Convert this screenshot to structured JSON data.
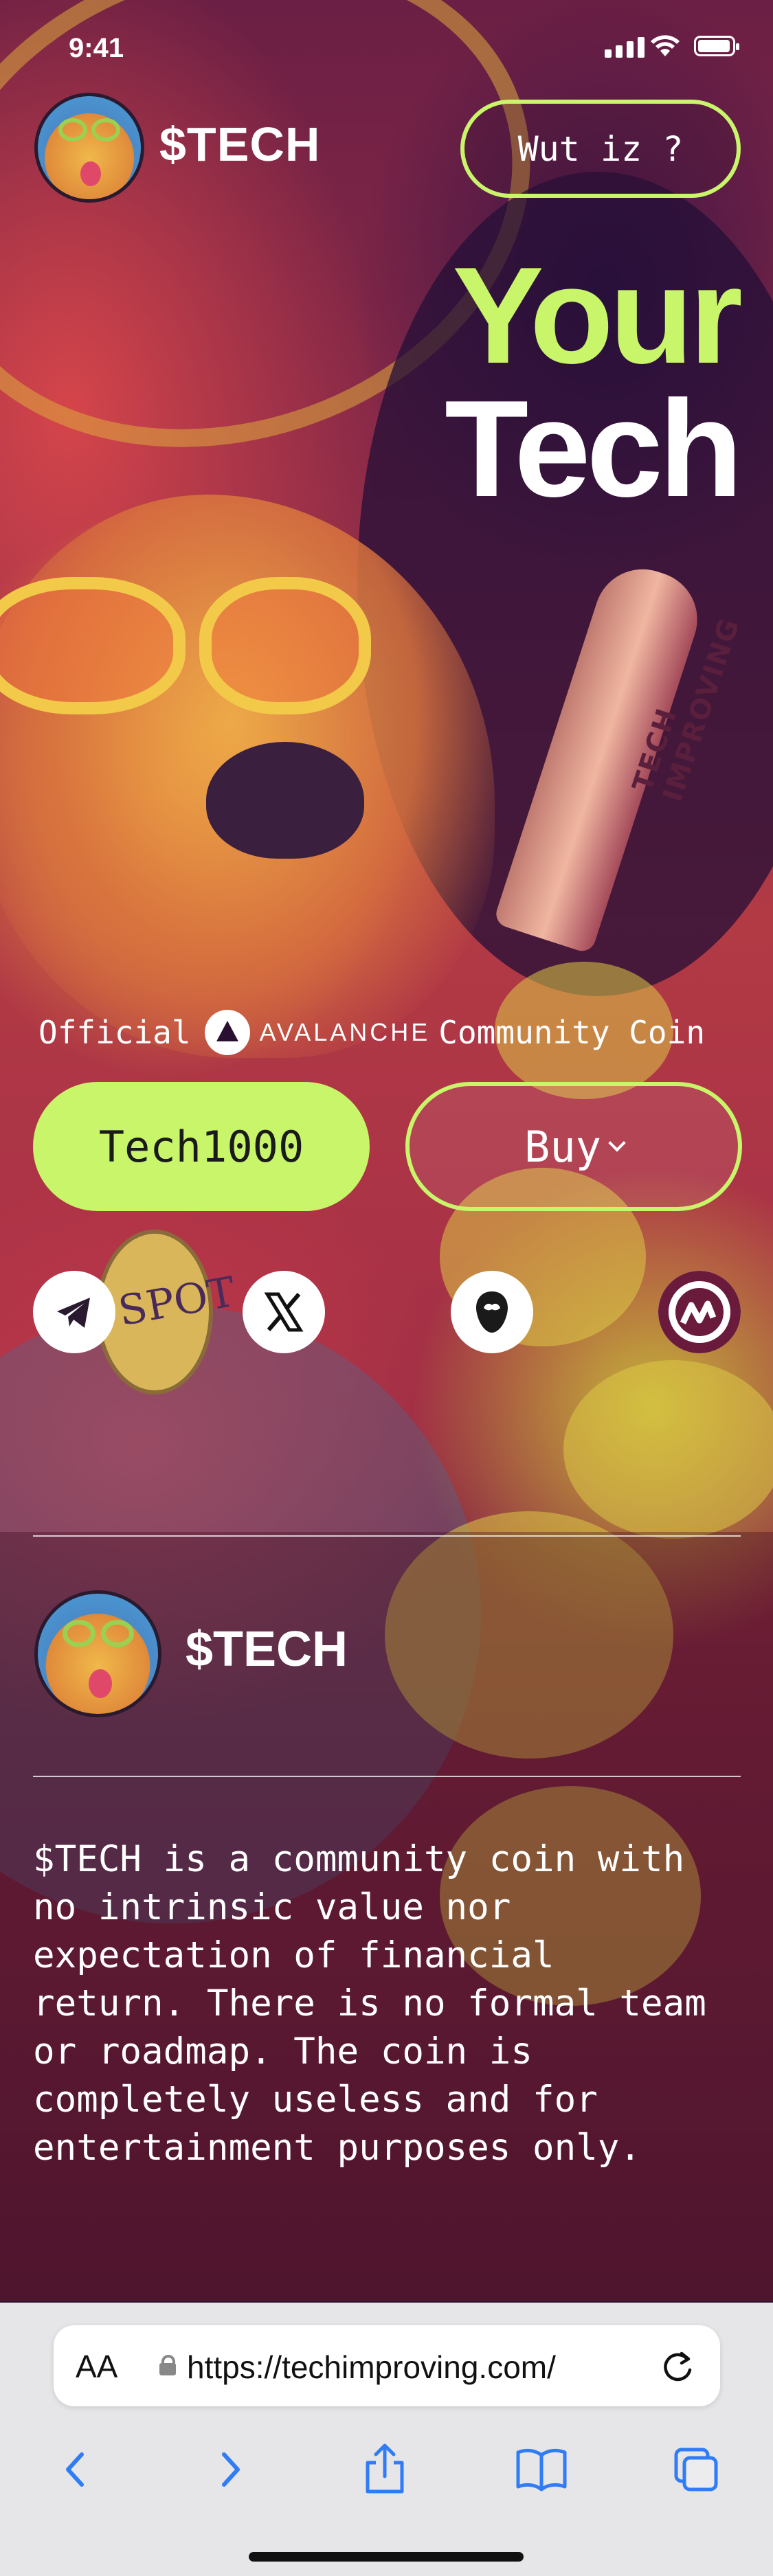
{
  "status_bar": {
    "time": "9:41"
  },
  "header": {
    "brand": "$TECH",
    "wut_button": "Wut iz ?"
  },
  "hero": {
    "line1": "Your",
    "line2": "Tech"
  },
  "official": {
    "prefix": "Official",
    "chain": "AVALANCHE",
    "suffix": "Community Coin"
  },
  "buttons": {
    "ticker": "Tech1000",
    "buy": "Buy"
  },
  "socials": [
    {
      "icon": "telegram-icon"
    },
    {
      "icon": "x-icon"
    },
    {
      "icon": "dexscreener-icon"
    },
    {
      "icon": "coinmarketcap-icon"
    }
  ],
  "background": {
    "rocket_text": "TECH IMPROVING",
    "tag_text": "SPOT"
  },
  "about": {
    "brand": "$TECH",
    "disclaimer": "$TECH is a community coin with\nno intrinsic value nor\nexpectation of financial\nreturn. There is no formal team\nor roadmap. The coin is\ncompletely useless and for\nentertainment purposes only."
  },
  "browser": {
    "aa": "AA",
    "url": "https://techimproving.com/"
  },
  "colors": {
    "accent": "#c8f56a",
    "ios_blue": "#2f7cf6"
  }
}
